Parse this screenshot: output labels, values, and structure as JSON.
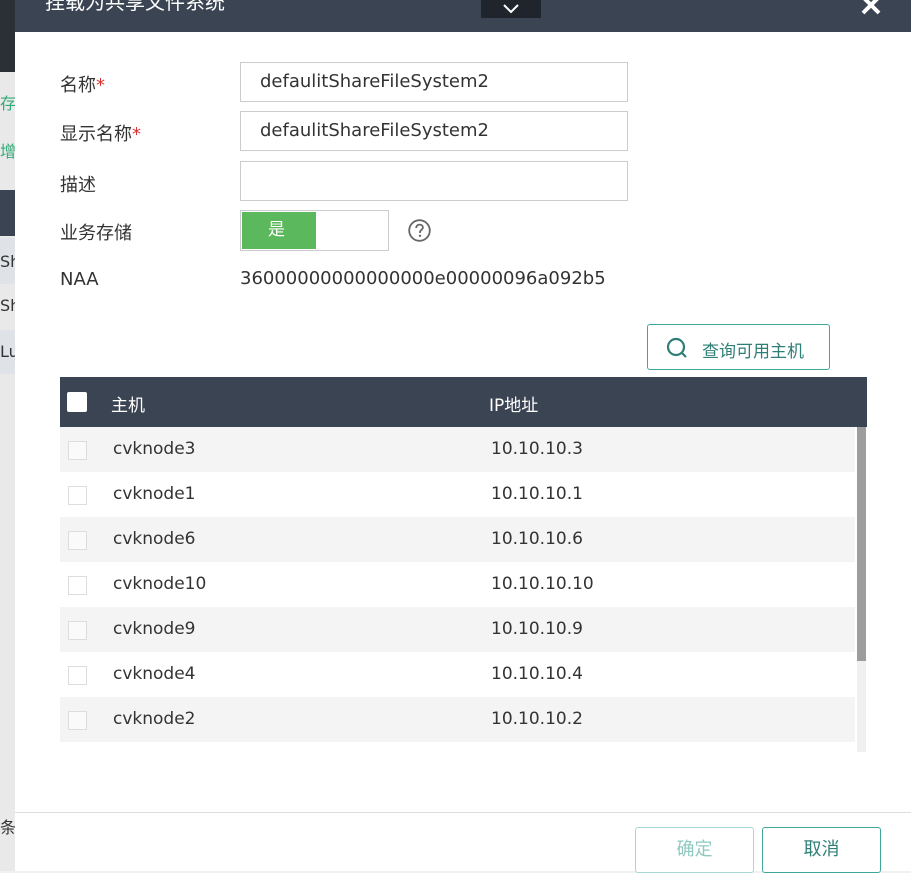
{
  "background": {
    "frag1": "存储",
    "frag2": "增加",
    "frag3": "Sh",
    "frag4": "Sh",
    "frag5": "Lu",
    "frag6": "条"
  },
  "dialog": {
    "title": "挂载为共享文件系统",
    "close_icon": "close-icon",
    "collapse_icon": "chevron-down-icon"
  },
  "form": {
    "name_label": "名称",
    "name_required": "*",
    "name_value": "defaulitShareFileSystem2",
    "display_name_label": "显示名称",
    "display_name_required": "*",
    "display_name_value": "defaulitShareFileSystem2",
    "description_label": "描述",
    "description_value": "",
    "service_storage_label": "业务存储",
    "service_storage_on": "是",
    "service_storage_enabled": true,
    "help_icon": "question-circle-icon",
    "naa_label": "NAA",
    "naa_value": "36000000000000000e00000096a092b5"
  },
  "query_button": {
    "label": "查询可用主机",
    "icon": "search-icon"
  },
  "table": {
    "columns": [
      "主机",
      "IP地址"
    ],
    "rows": [
      {
        "host": "cvknode3",
        "ip": "10.10.10.3"
      },
      {
        "host": "cvknode1",
        "ip": "10.10.10.1"
      },
      {
        "host": "cvknode6",
        "ip": "10.10.10.6"
      },
      {
        "host": "cvknode10",
        "ip": "10.10.10.10"
      },
      {
        "host": "cvknode9",
        "ip": "10.10.10.9"
      },
      {
        "host": "cvknode4",
        "ip": "10.10.10.4"
      },
      {
        "host": "cvknode2",
        "ip": "10.10.10.2"
      }
    ]
  },
  "footer": {
    "ok_label": "确定",
    "cancel_label": "取消"
  },
  "colors": {
    "header_bg": "#3b4452",
    "accent": "#3ea79a",
    "toggle_on": "#5cb85c",
    "required": "#dd3333"
  }
}
